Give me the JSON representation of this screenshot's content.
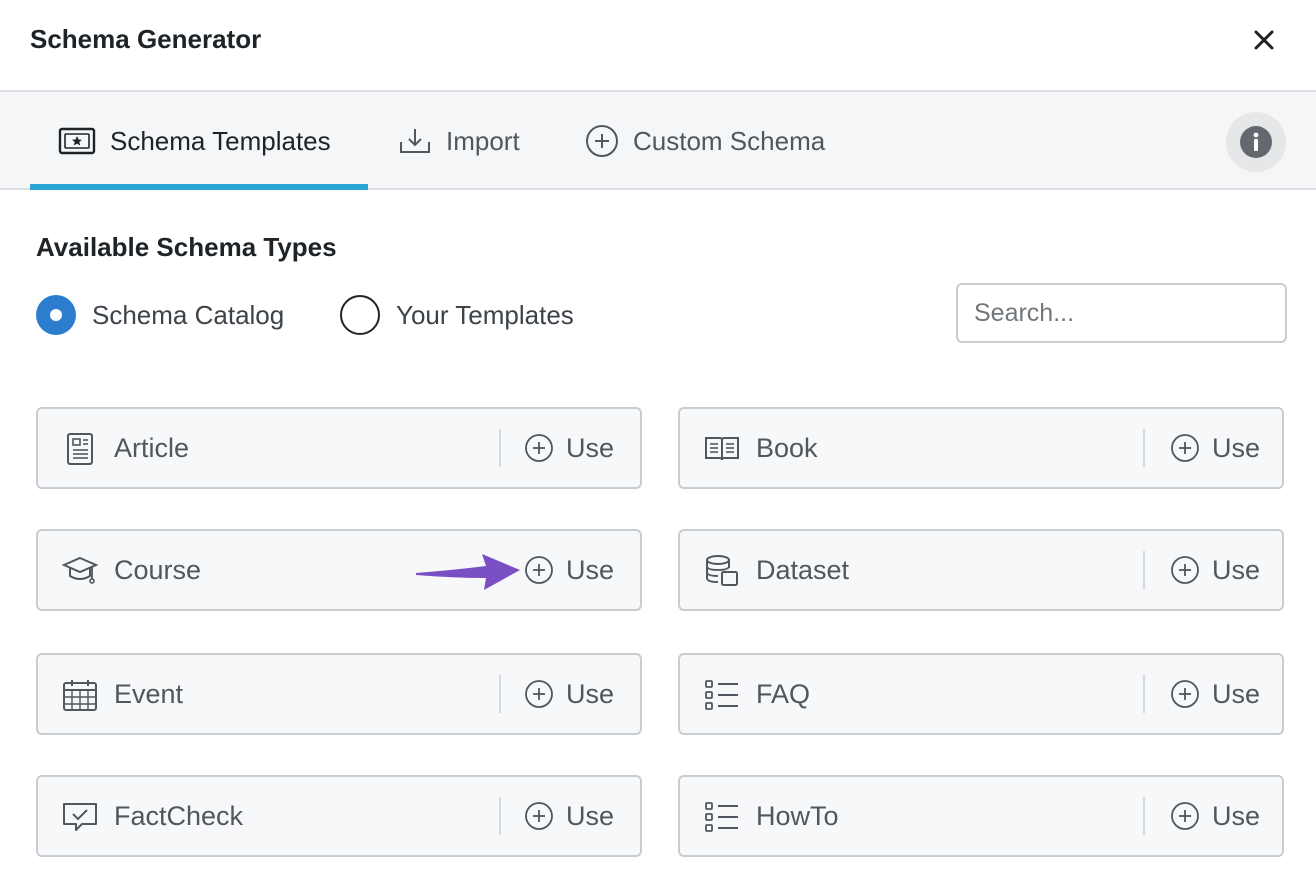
{
  "dialog": {
    "title": "Schema Generator"
  },
  "tabs": [
    {
      "label": "Schema Templates",
      "icon": "certificate-icon",
      "active": true
    },
    {
      "label": "Import",
      "icon": "import-icon",
      "active": false
    },
    {
      "label": "Custom Schema",
      "icon": "plus-circle-icon",
      "active": false
    }
  ],
  "section": {
    "title": "Available Schema Types"
  },
  "filter": {
    "options": [
      {
        "label": "Schema Catalog",
        "selected": true
      },
      {
        "label": "Your Templates",
        "selected": false
      }
    ]
  },
  "search": {
    "placeholder": "Search..."
  },
  "schema_types": [
    {
      "name": "Article",
      "icon": "article-icon",
      "action": "Use"
    },
    {
      "name": "Book",
      "icon": "book-icon",
      "action": "Use"
    },
    {
      "name": "Course",
      "icon": "graduation-cap-icon",
      "action": "Use"
    },
    {
      "name": "Dataset",
      "icon": "database-icon",
      "action": "Use"
    },
    {
      "name": "Event",
      "icon": "calendar-icon",
      "action": "Use"
    },
    {
      "name": "FAQ",
      "icon": "list-icon",
      "action": "Use"
    },
    {
      "name": "FactCheck",
      "icon": "fact-check-icon",
      "action": "Use"
    },
    {
      "name": "HowTo",
      "icon": "list-icon",
      "action": "Use"
    }
  ],
  "colors": {
    "accent": "#2aa3d6",
    "radio_selected": "#2c7dcd",
    "annotation_arrow": "#7b4fc4"
  }
}
